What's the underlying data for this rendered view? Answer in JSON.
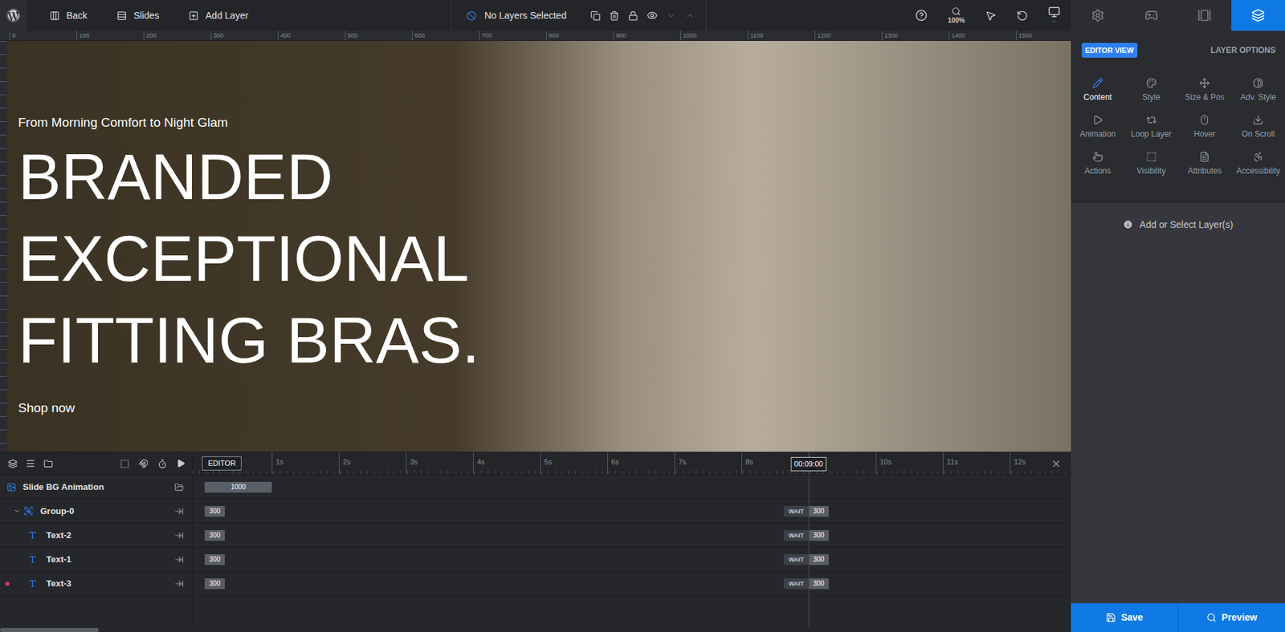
{
  "topbar": {
    "back": "Back",
    "slides": "Slides",
    "add_layer": "Add Layer",
    "selection": "No Layers Selected",
    "zoom": "100%",
    "move_down_disabled": true,
    "move_up_disabled": true
  },
  "ruler": {
    "ticks": [
      "0",
      "100",
      "200",
      "300",
      "400",
      "500",
      "600",
      "700",
      "800",
      "900",
      "1000",
      "1100",
      "1200",
      "1300",
      "1400",
      "1500"
    ]
  },
  "canvas": {
    "subtitle": "From Morning Comfort to Night Glam",
    "headline": [
      "BRANDED",
      "EXCEPTIONAL",
      "FITTING BRAS."
    ],
    "button": "Shop now"
  },
  "timeline": {
    "mode": "EDITOR",
    "ticks": [
      "1s",
      "2s",
      "3s",
      "4s",
      "5s",
      "6s",
      "7s",
      "8s",
      "9s",
      "10s",
      "11s",
      "12s"
    ],
    "playhead": "00:09:00",
    "rows": [
      {
        "label": "Slide BG Animation",
        "kind": "slide",
        "duration": "1000"
      },
      {
        "label": "Group-0",
        "kind": "group",
        "expanded": true,
        "marked": false,
        "in": "300",
        "wait": "WAIT",
        "out": "300"
      },
      {
        "label": "Text-2",
        "kind": "text",
        "marked": false,
        "in": "300",
        "wait": "WAIT",
        "out": "300"
      },
      {
        "label": "Text-1",
        "kind": "text",
        "marked": false,
        "in": "300",
        "wait": "WAIT",
        "out": "300"
      },
      {
        "label": "Text-3",
        "kind": "text",
        "marked": true,
        "in": "300",
        "wait": "WAIT",
        "out": "300"
      }
    ]
  },
  "sidebar": {
    "tabs": [
      {
        "selected": false
      },
      {
        "selected": false
      },
      {
        "selected": false
      },
      {
        "selected": true
      }
    ],
    "view": {
      "label": "EDITOR VIEW",
      "selected": true
    },
    "layer_options": {
      "label": "LAYER OPTIONS",
      "selected": false
    },
    "options": [
      {
        "label": "Content",
        "selected": true
      },
      {
        "label": "Style",
        "selected": false
      },
      {
        "label": "Size & Pos",
        "selected": false
      },
      {
        "label": "Adv. Style",
        "selected": false
      },
      {
        "label": "Animation",
        "selected": false
      },
      {
        "label": "Loop Layer",
        "selected": false
      },
      {
        "label": "Hover",
        "selected": false
      },
      {
        "label": "On Scroll",
        "selected": false
      },
      {
        "label": "Actions",
        "selected": false
      },
      {
        "label": "Visibility",
        "selected": false
      },
      {
        "label": "Attributes",
        "selected": false
      },
      {
        "label": "Accessibility",
        "selected": false
      }
    ],
    "info": "Add or Select Layer(s)",
    "save": "Save",
    "preview": "Preview"
  }
}
